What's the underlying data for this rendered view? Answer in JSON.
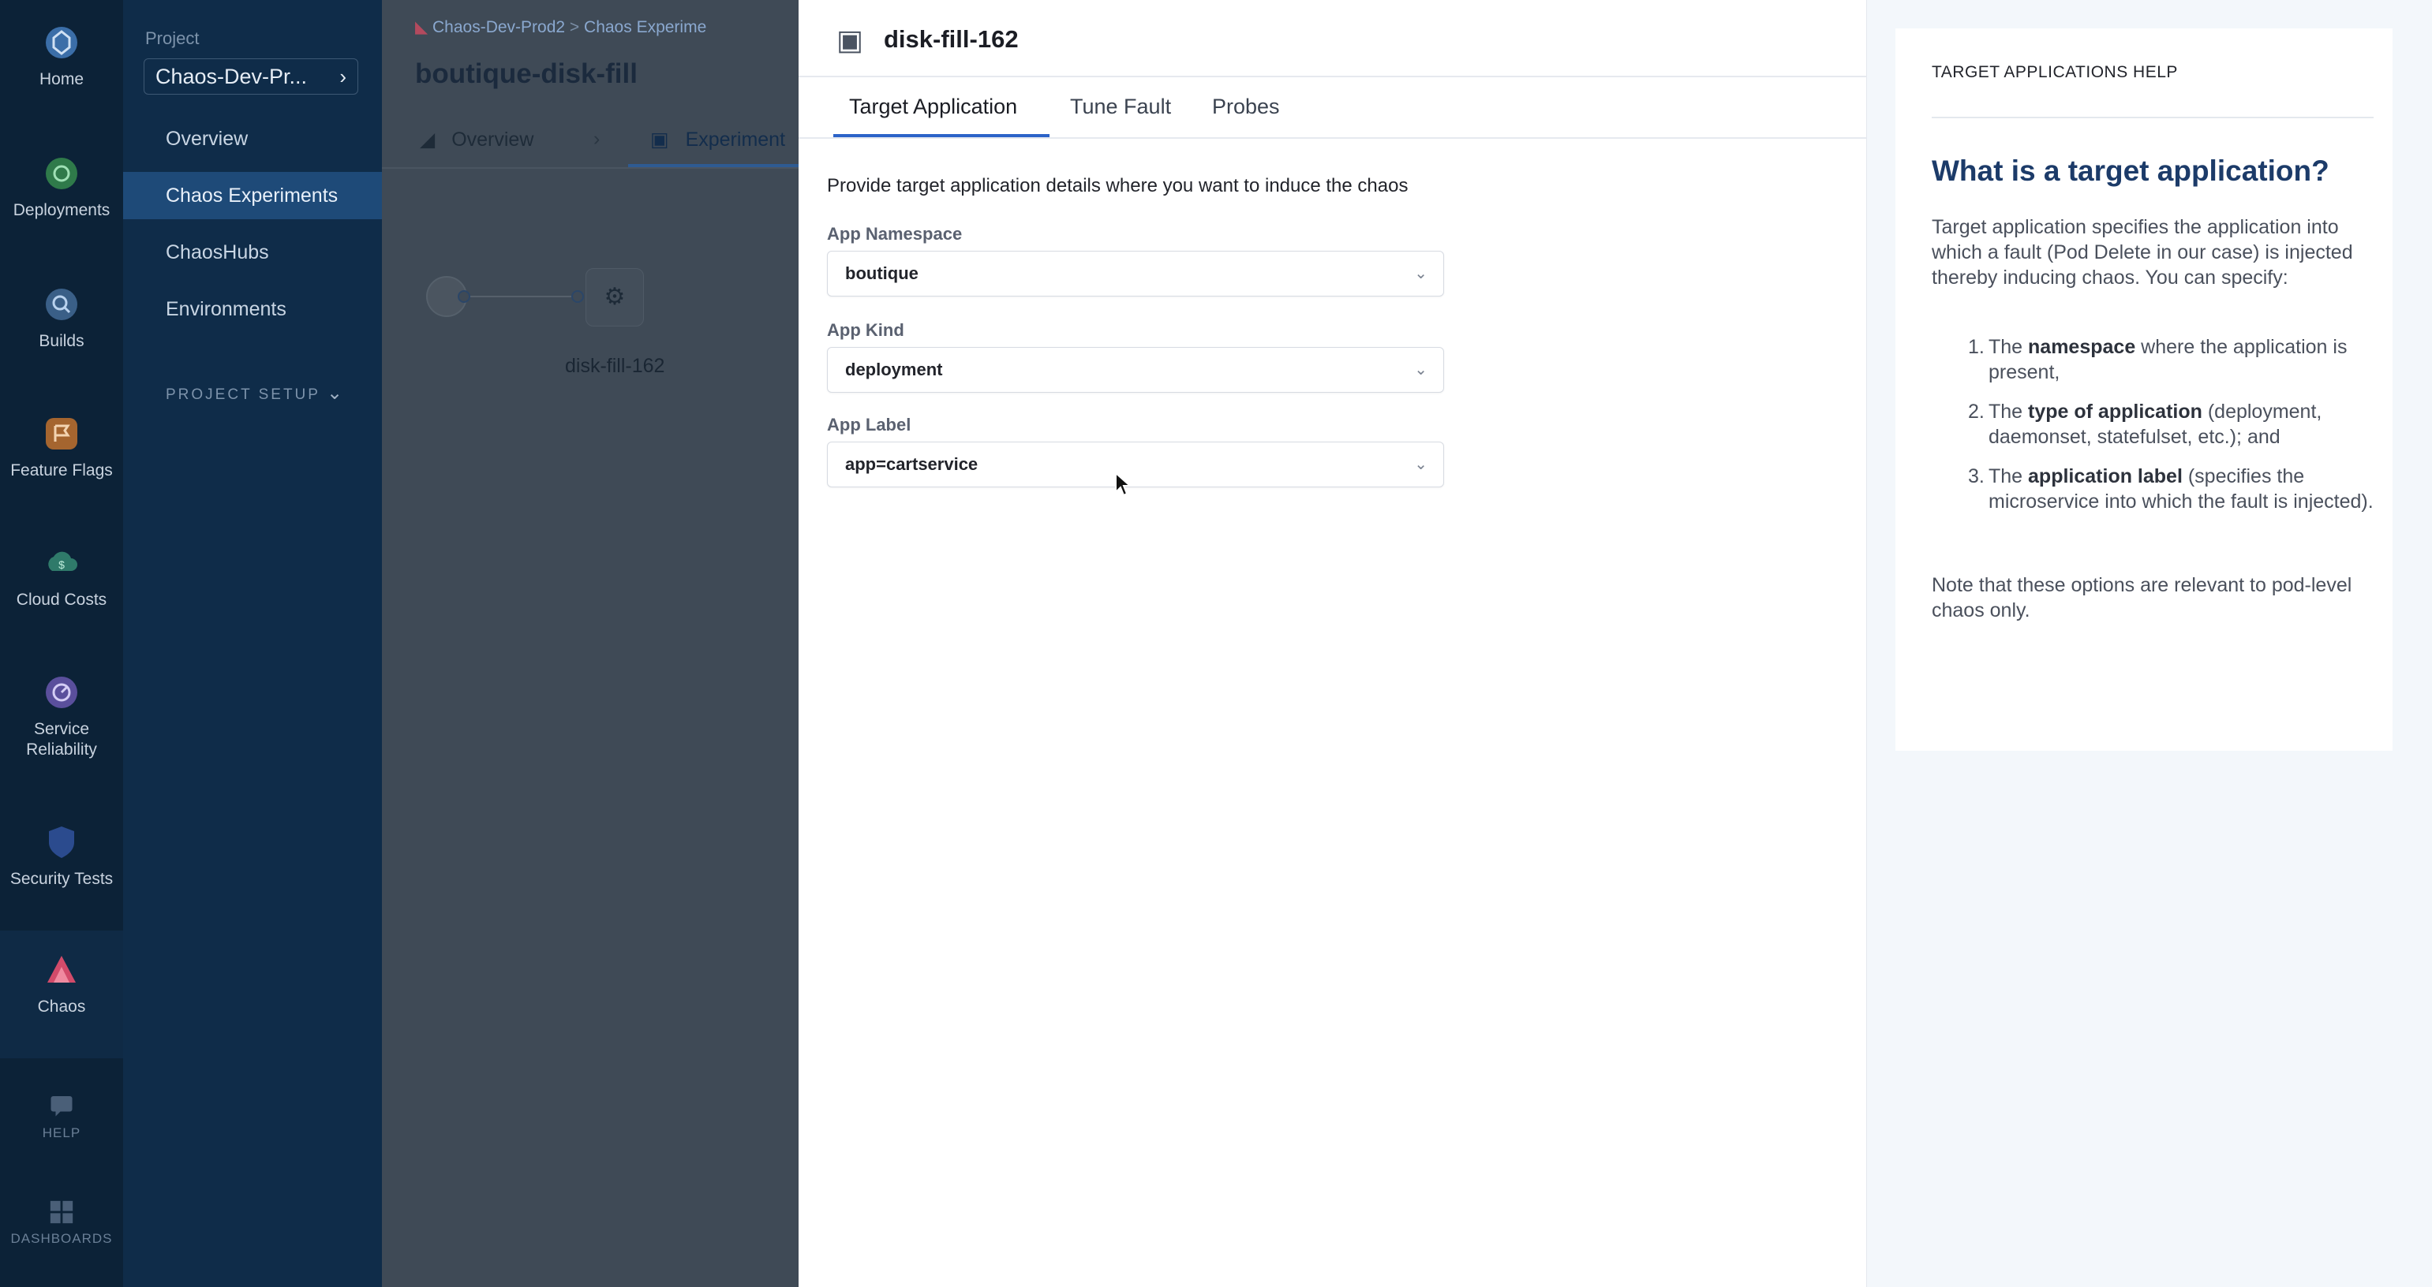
{
  "nav": {
    "items": [
      {
        "label": "Home",
        "icon": "home-icon"
      },
      {
        "label": "Deployments",
        "icon": "deployments-icon"
      },
      {
        "label": "Builds",
        "icon": "builds-icon"
      },
      {
        "label": "Feature Flags",
        "icon": "feature-flags-icon"
      },
      {
        "label": "Cloud Costs",
        "icon": "cloud-costs-icon"
      },
      {
        "label": "Service Reliability",
        "icon": "service-reliability-icon"
      },
      {
        "label": "Security Tests",
        "icon": "security-tests-icon"
      },
      {
        "label": "Chaos",
        "icon": "chaos-icon"
      },
      {
        "label": "HELP",
        "icon": "help-icon"
      },
      {
        "label": "DASHBOARDS",
        "icon": "dashboards-icon"
      }
    ]
  },
  "sidebar": {
    "project_label": "Project",
    "project_value": "Chaos-Dev-Pr...",
    "links": [
      "Overview",
      "Chaos Experiments",
      "ChaosHubs",
      "Environments"
    ],
    "setup_label": "PROJECT SETUP"
  },
  "canvas": {
    "breadcrumb_1": "Chaos-Dev-Prod2",
    "breadcrumb_sep": ">",
    "breadcrumb_2": "Chaos Experime",
    "experiment_title": "boutique-disk-fill",
    "tab_overview": "Overview",
    "tab_experiment": "Experiment",
    "node_label": "disk-fill-162"
  },
  "drawer": {
    "close_label": "×",
    "title": "disk-fill-162",
    "tabs": [
      "Target Application",
      "Tune Fault",
      "Probes"
    ],
    "intro": "Provide target application details where you want to induce the chaos",
    "fields": [
      {
        "label": "App Namespace",
        "value": "boutique"
      },
      {
        "label": "App Kind",
        "value": "deployment"
      },
      {
        "label": "App Label",
        "value": "app=cartservice"
      }
    ]
  },
  "help": {
    "header": "TARGET APPLICATIONS HELP",
    "title": "What is a target application?",
    "body": "Target application specifies the application into which a fault (Pod Delete in our case) is injected thereby inducing chaos. You can specify:",
    "list": [
      {
        "num": "1.",
        "pre": "The ",
        "bold": "namespace",
        "post": " where the application is present,"
      },
      {
        "num": "2.",
        "pre": "The ",
        "bold": "type of application",
        "post": " (deployment, daemonset, statefulset, etc.); and"
      },
      {
        "num": "3.",
        "pre": "The ",
        "bold": "application label",
        "post": " (specifies the microservice into which the fault is injected)."
      }
    ],
    "note": "Note that these options are relevant to pod-level chaos only."
  }
}
